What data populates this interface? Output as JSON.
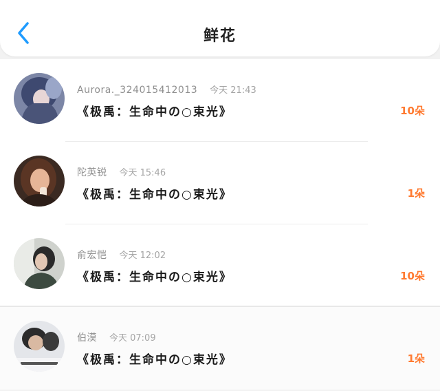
{
  "header": {
    "title": "鲜花"
  },
  "records": [
    {
      "name": "Aurora._324015412013",
      "time": "今天 21:43",
      "work": "《极禹：生命中の○束光》",
      "count": "10朵"
    },
    {
      "name": "陀英锐",
      "time": "今天 15:46",
      "work": "《极禹：生命中の○束光》",
      "count": "1朵"
    },
    {
      "name": "俞宏恺",
      "time": "今天 12:02",
      "work": "《极禹：生命中の○束光》",
      "count": "10朵"
    },
    {
      "name": "伯漠",
      "time": "今天 07:09",
      "work": "《极禹：生命中の○束光》",
      "count": "1朵"
    }
  ],
  "colors": {
    "accent": "#1e9bff",
    "count": "#ff7a30"
  },
  "icons": {
    "back": "chevron-left-icon"
  }
}
